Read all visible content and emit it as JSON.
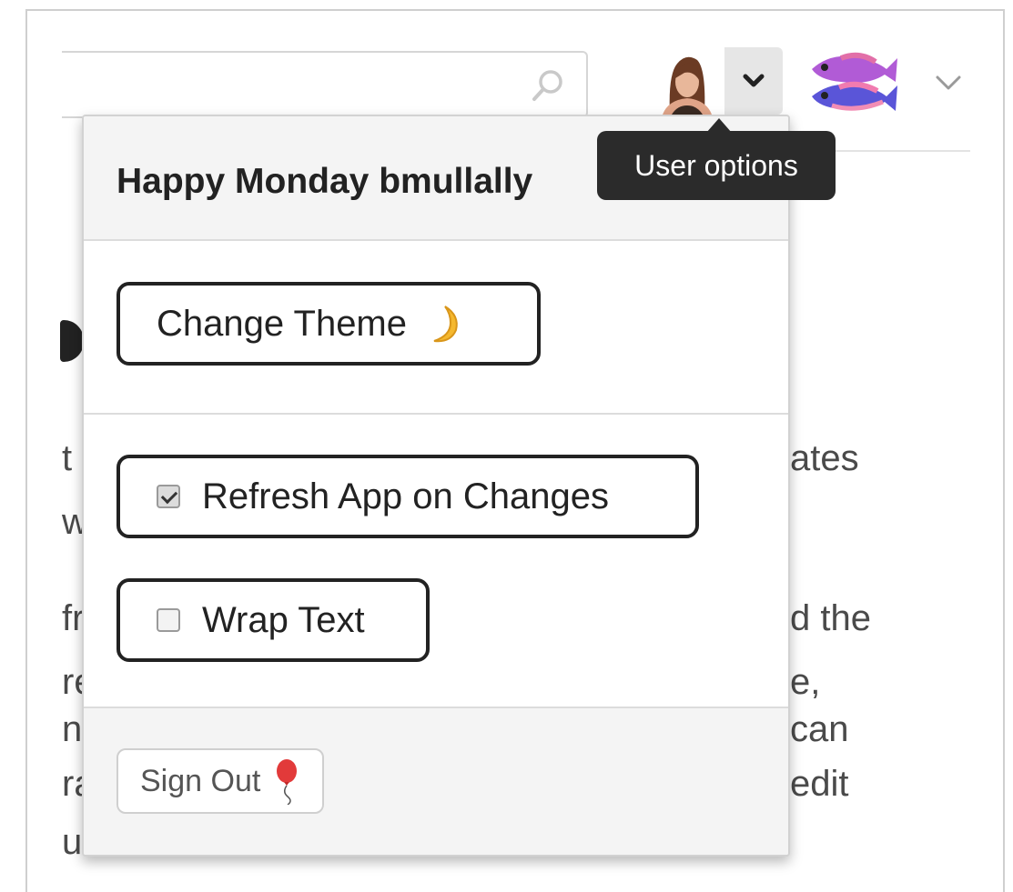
{
  "header": {
    "search_icon": "search-icon",
    "user_menu_chevron": "chevron-down-icon",
    "app_switcher_chevron": "chevron-down-icon"
  },
  "tooltip": {
    "text": "User options"
  },
  "background_text": {
    "line1_left": "t",
    "line1_right": "ates",
    "line2_left": "w",
    "line3_left": "fr",
    "line3_right": "d the",
    "line4_left": "re",
    "line4_right": "e,",
    "line5_left": "n",
    "line5_right": "can",
    "line6_left": "ra",
    "line6_right": "edit",
    "line7_left": "u."
  },
  "user_menu": {
    "greeting": "Happy Monday bmullally",
    "change_theme_label": "Change Theme",
    "change_theme_icon": "moon-icon",
    "refresh_label": "Refresh App on Changes",
    "refresh_checked": true,
    "wrap_label": "Wrap Text",
    "wrap_checked": false,
    "sign_out_label": "Sign Out",
    "sign_out_icon": "balloon-icon"
  }
}
